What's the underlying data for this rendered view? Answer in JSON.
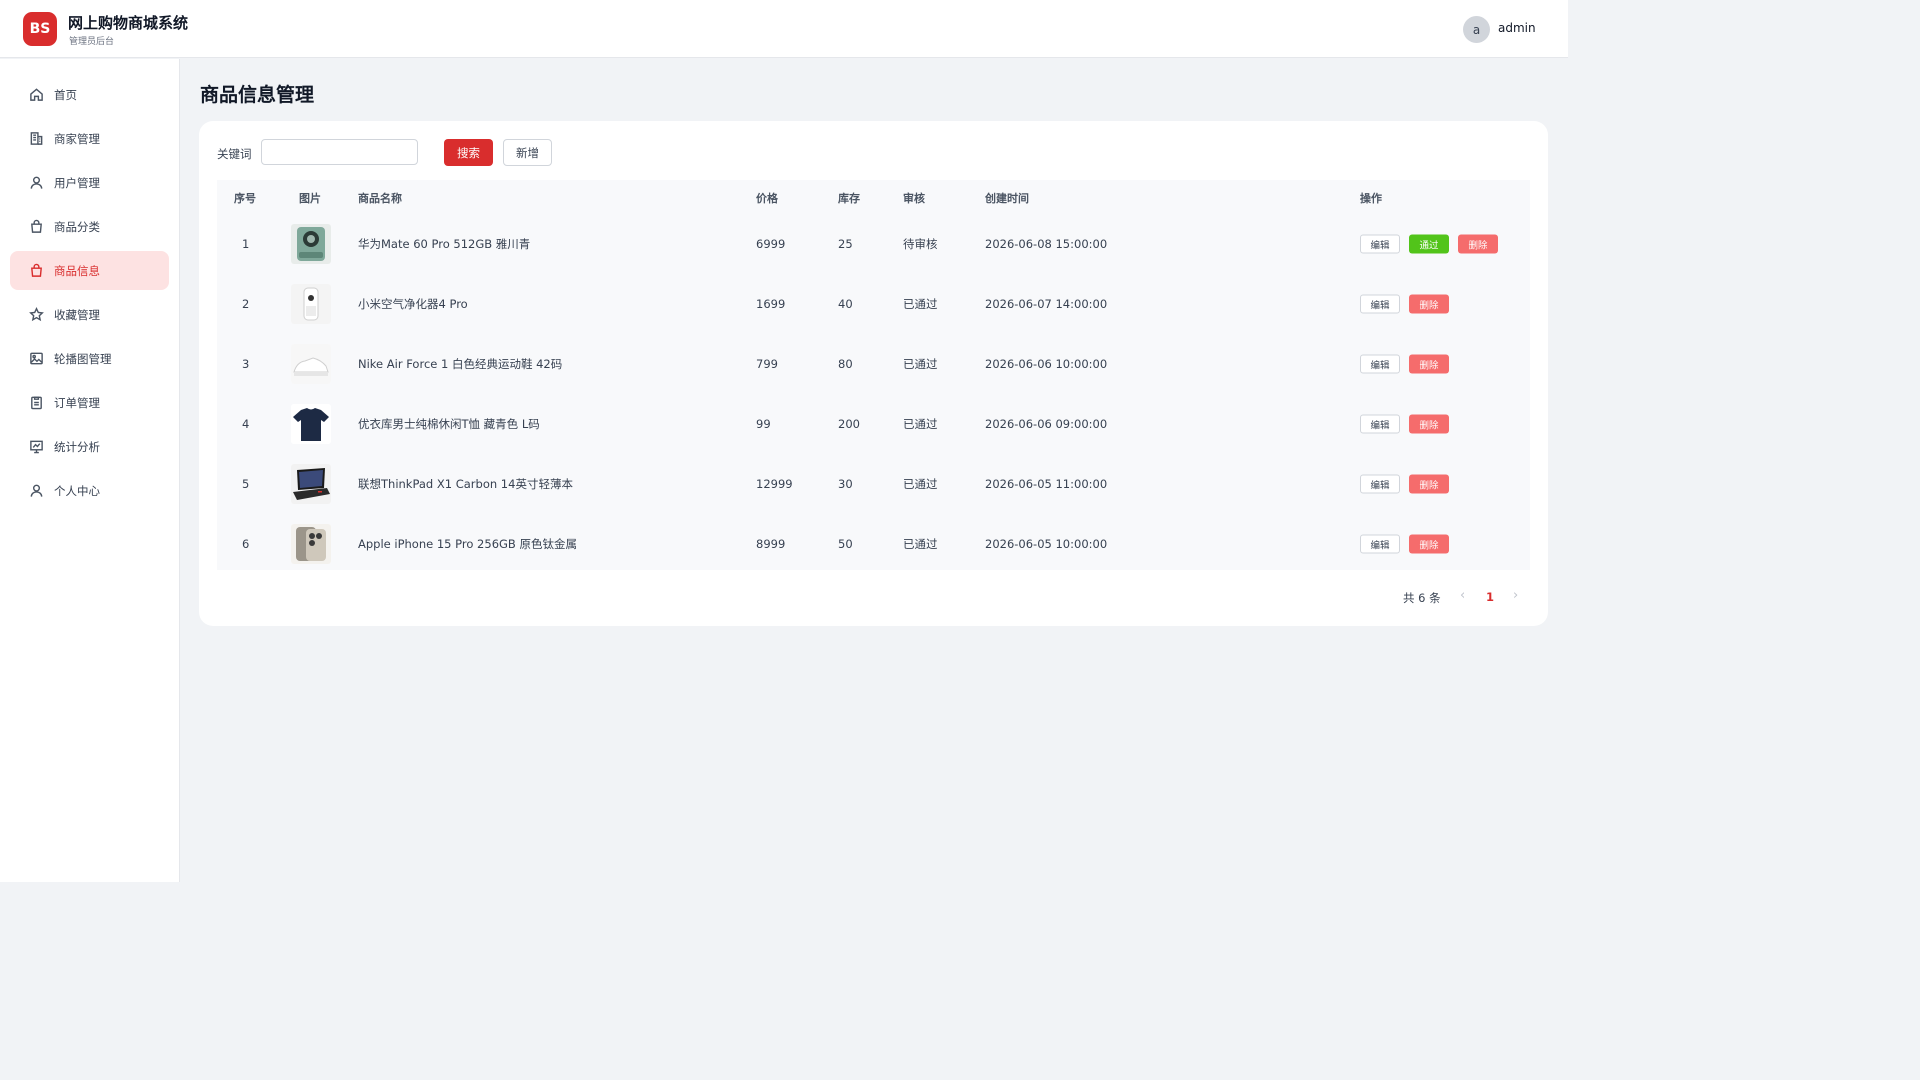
{
  "header": {
    "logo_text": "BS",
    "title": "网上购物商城系统",
    "subtitle": "管理员后台",
    "avatar_letter": "a",
    "username": "admin"
  },
  "sidebar": {
    "items": [
      {
        "label": "首页",
        "icon": "home-icon",
        "active": false
      },
      {
        "label": "商家管理",
        "icon": "building-icon",
        "active": false
      },
      {
        "label": "用户管理",
        "icon": "user-icon",
        "active": false
      },
      {
        "label": "商品分类",
        "icon": "shopping-bag-icon",
        "active": false
      },
      {
        "label": "商品信息",
        "icon": "shopping-bag-icon",
        "active": true
      },
      {
        "label": "收藏管理",
        "icon": "star-icon",
        "active": false
      },
      {
        "label": "轮播图管理",
        "icon": "image-icon",
        "active": false
      },
      {
        "label": "订单管理",
        "icon": "clipboard-icon",
        "active": false
      },
      {
        "label": "统计分析",
        "icon": "chart-icon",
        "active": false
      },
      {
        "label": "个人中心",
        "icon": "user-icon",
        "active": false
      }
    ]
  },
  "main": {
    "page_title": "商品信息管理",
    "search": {
      "label": "关键词",
      "value": "",
      "placeholder": ""
    },
    "search_button": "搜索",
    "add_button": "新增",
    "table": {
      "columns": [
        "序号",
        "图片",
        "商品名称",
        "价格",
        "库存",
        "审核",
        "创建时间",
        "操作"
      ],
      "rows": [
        {
          "index": "1",
          "image": "phone-green-thumbnail",
          "name": "华为Mate 60 Pro 512GB 雅川青",
          "price": "6999",
          "stock": "25",
          "status": "待审核",
          "created": "2026-06-08 15:00:00",
          "actions": [
            "编辑",
            "通过",
            "删除"
          ]
        },
        {
          "index": "2",
          "image": "air-purifier-thumbnail",
          "name": "小米空气净化器4 Pro",
          "price": "1699",
          "stock": "40",
          "status": "已通过",
          "created": "2026-06-07 14:00:00",
          "actions": [
            "编辑",
            "删除"
          ]
        },
        {
          "index": "3",
          "image": "sneaker-thumbnail",
          "name": "Nike Air Force 1 白色经典运动鞋 42码",
          "price": "799",
          "stock": "80",
          "status": "已通过",
          "created": "2026-06-06 10:00:00",
          "actions": [
            "编辑",
            "删除"
          ]
        },
        {
          "index": "4",
          "image": "tshirt-thumbnail",
          "name": "优衣库男士纯棉休闲T恤 藏青色 L码",
          "price": "99",
          "stock": "200",
          "status": "已通过",
          "created": "2026-06-06 09:00:00",
          "actions": [
            "编辑",
            "删除"
          ]
        },
        {
          "index": "5",
          "image": "laptop-thumbnail",
          "name": "联想ThinkPad X1 Carbon 14英寸轻薄本",
          "price": "12999",
          "stock": "30",
          "status": "已通过",
          "created": "2026-06-05 11:00:00",
          "actions": [
            "编辑",
            "删除"
          ]
        },
        {
          "index": "6",
          "image": "iphone-thumbnail",
          "name": "Apple iPhone 15 Pro 256GB 原色钛金属",
          "price": "8999",
          "stock": "50",
          "status": "已通过",
          "created": "2026-06-05 10:00:00",
          "actions": [
            "编辑",
            "删除"
          ]
        }
      ]
    },
    "pagination": {
      "total_text": "共 6 条",
      "current_page": "1",
      "prev": "‹",
      "next": "›"
    }
  },
  "colors": {
    "primary": "#d92d2d",
    "approve": "#52c41a",
    "delete": "#f56c6c",
    "active_nav_bg": "#fde2e2"
  }
}
